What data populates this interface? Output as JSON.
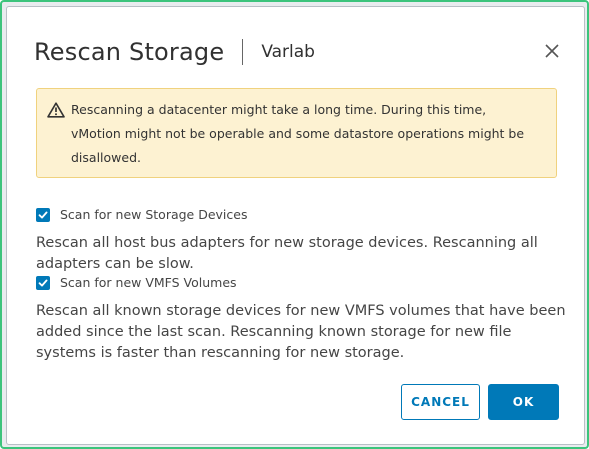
{
  "dialog": {
    "title": "Rescan Storage",
    "subtitle": "Varlab",
    "close_icon": "close-icon"
  },
  "warning": {
    "icon": "warning-triangle-icon",
    "text": "Rescanning a datacenter might take a long time. During this time, vMotion might not be operable and some datastore operations might be disallowed."
  },
  "options": [
    {
      "label": "Scan for new Storage Devices",
      "checked": true,
      "description": "Rescan all host bus adapters for new storage devices. Rescanning all adapters can be slow."
    },
    {
      "label": "Scan for new VMFS Volumes",
      "checked": true,
      "description": "Rescan all known storage devices for new VMFS volumes that have been added since the last scan. Rescanning known storage for new file systems is faster than rescanning for new storage."
    }
  ],
  "buttons": {
    "cancel_label": "CANCEL",
    "ok_label": "OK"
  },
  "colors": {
    "accent": "#0079b8",
    "warning_bg": "#fdf2d2",
    "warning_border": "#f0d27e",
    "frame_border": "#3cc47c"
  }
}
